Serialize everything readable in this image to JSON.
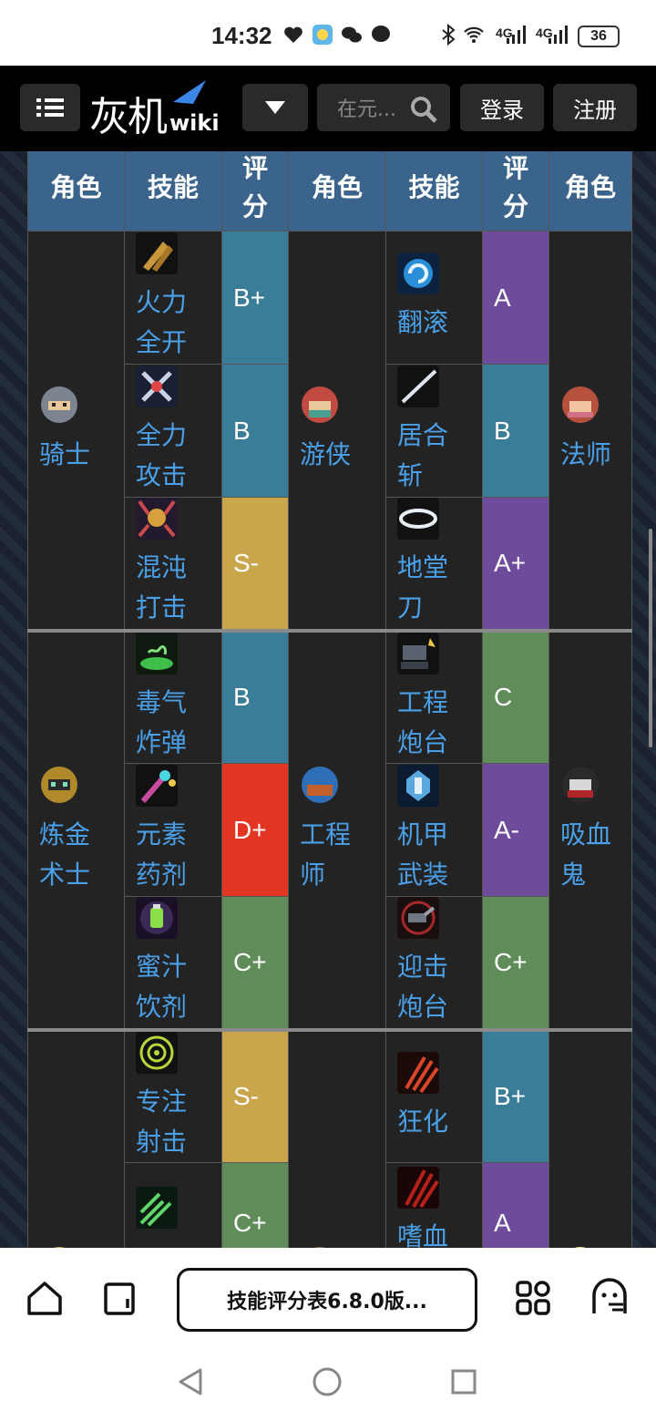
{
  "status_bar": {
    "time": "14:32",
    "network_1": "4G",
    "network_2": "4G",
    "battery": "36"
  },
  "header": {
    "logo_text": "灰机",
    "logo_sub": "wiki",
    "search_placeholder": "在元...",
    "login_label": "登录",
    "register_label": "注册"
  },
  "table": {
    "headers": [
      "角色",
      "技能",
      "评分",
      "角色",
      "技能",
      "评分",
      "角色"
    ],
    "headers_score_lines": [
      "评",
      "分"
    ],
    "groups": [
      {
        "role1": "骑士",
        "role2": "游侠",
        "role3": "法师",
        "rows": [
          {
            "skill1": [
              "火力",
              "全开"
            ],
            "score1": "B+",
            "skill2": [
              "翻滚"
            ],
            "score2": "A"
          },
          {
            "skill1": [
              "全力",
              "攻击"
            ],
            "score1": "B",
            "skill2": [
              "居合",
              "斩"
            ],
            "score2": "B"
          },
          {
            "skill1": [
              "混沌",
              "打击"
            ],
            "score1": "S-",
            "skill2": [
              "地堂",
              "刀"
            ],
            "score2": "A+"
          }
        ]
      },
      {
        "role1": "炼金术士",
        "role1_lines": [
          "炼金",
          "术士"
        ],
        "role2_lines": [
          "工程",
          "师"
        ],
        "role3_lines": [
          "吸血",
          "鬼"
        ],
        "rows": [
          {
            "skill1": [
              "毒气",
              "炸弹"
            ],
            "score1": "B",
            "skill2": [
              "工程",
              "炮台"
            ],
            "score2": "C"
          },
          {
            "skill1": [
              "元素",
              "药剂"
            ],
            "score1": "D+",
            "skill2": [
              "机甲",
              "武装"
            ],
            "score2": "A-"
          },
          {
            "skill1": [
              "蜜汁",
              "饮剂"
            ],
            "score1": "C+",
            "skill2": [
              "迎击",
              "炮台"
            ],
            "score2": "C+"
          }
        ]
      },
      {
        "rows": [
          {
            "skill1": [
              "专注",
              "射击"
            ],
            "score1": "S-",
            "skill2": [
              "狂化"
            ],
            "score2": "B+"
          },
          {
            "skill1": [],
            "score1": "C+",
            "skill2": [
              "嗜血"
            ],
            "score2": "A"
          }
        ]
      }
    ],
    "score_colors": {
      "B+": "#3a7d99",
      "B": "#3a7d99",
      "A": "#6f4b9c",
      "A+": "#6f4b9c",
      "A-": "#6f4b9c",
      "S-": "#c9a64b",
      "C": "#5f8c58",
      "C+": "#5f8c58",
      "D+": "#e23622"
    }
  },
  "bottom": {
    "tab_title": "技能评分表6.8.0版..."
  }
}
